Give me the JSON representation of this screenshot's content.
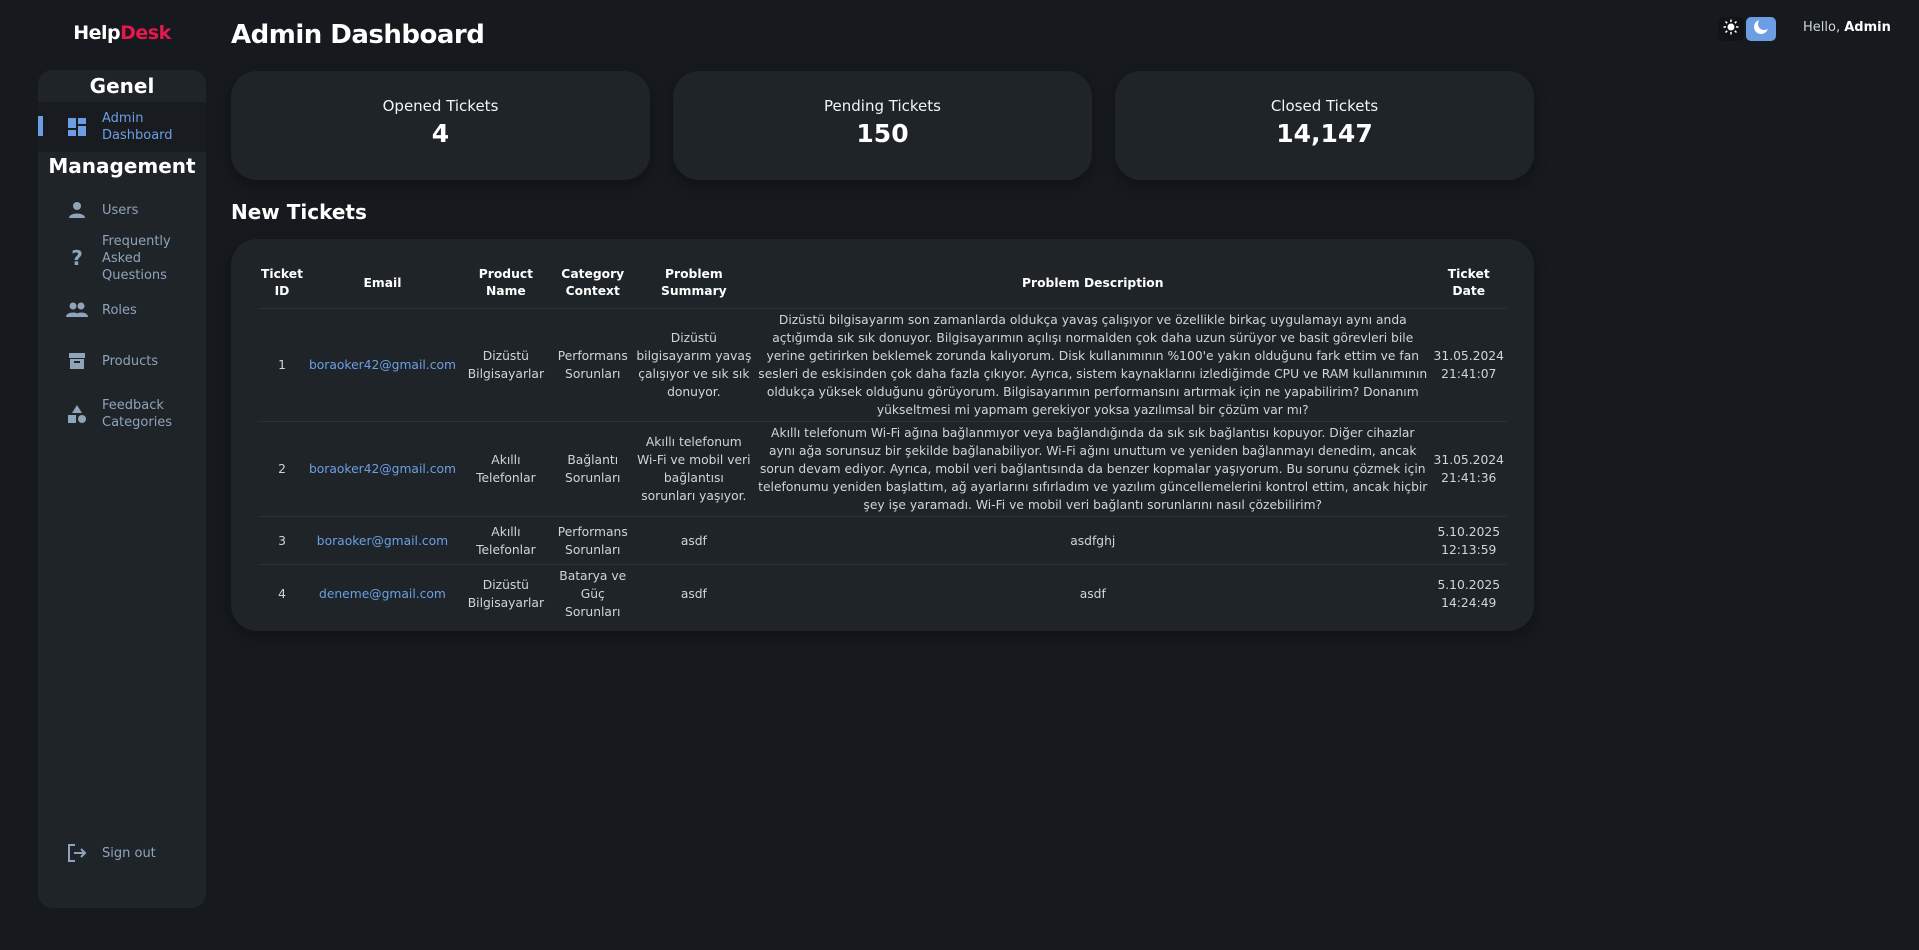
{
  "brand": {
    "part1": "Help",
    "part2": "Desk"
  },
  "sidebar": {
    "section_general": "Genel",
    "section_management": "Management",
    "items": [
      {
        "label": "Admin Dashboard",
        "icon": "dashboard-icon"
      },
      {
        "label": "Users",
        "icon": "user-icon"
      },
      {
        "label": "Frequently Asked Questions",
        "icon": "question-icon"
      },
      {
        "label": "Roles",
        "icon": "group-icon"
      },
      {
        "label": "Products",
        "icon": "archive-icon"
      },
      {
        "label": "Feedback Categories",
        "icon": "category-icon"
      }
    ],
    "sign_out": "Sign out"
  },
  "header": {
    "title": "Admin Dashboard",
    "greeting_prefix": "Hello, ",
    "user": "Admin"
  },
  "stats": [
    {
      "label": "Opened Tickets",
      "value": "4"
    },
    {
      "label": "Pending Tickets",
      "value": "150"
    },
    {
      "label": "Closed Tickets",
      "value": "14,147"
    }
  ],
  "tickets": {
    "heading": "New Tickets",
    "columns": [
      "Ticket ID",
      "Email",
      "Product Name",
      "Category Context",
      "Problem Summary",
      "Problem Description",
      "Ticket Date"
    ],
    "rows": [
      {
        "id": "1",
        "email": "boraoker42@gmail.com",
        "product": "Dizüstü Bilgisayarlar",
        "category": "Performans Sorunları",
        "summary": "Dizüstü bilgisayarım yavaş çalışıyor ve sık sık donuyor.",
        "description": "Dizüstü bilgisayarım son zamanlarda oldukça yavaş çalışıyor ve özellikle birkaç uygulamayı aynı anda açtığımda sık sık donuyor. Bilgisayarımın açılışı normalden çok daha uzun sürüyor ve basit görevleri bile yerine getirirken beklemek zorunda kalıyorum. Disk kullanımının %100'e yakın olduğunu fark ettim ve fan sesleri de eskisinden çok daha fazla çıkıyor. Ayrıca, sistem kaynaklarını izlediğimde CPU ve RAM kullanımının oldukça yüksek olduğunu görüyorum. Bilgisayarımın performansını artırmak için ne yapabilirim? Donanım yükseltmesi mi yapmam gerekiyor yoksa yazılımsal bir çözüm var mı?",
        "date": "31.05.2024 21:41:07"
      },
      {
        "id": "2",
        "email": "boraoker42@gmail.com",
        "product": "Akıllı Telefonlar",
        "category": "Bağlantı Sorunları",
        "summary": "Akıllı telefonum Wi-Fi ve mobil veri bağlantısı sorunları yaşıyor.",
        "description": "Akıllı telefonum Wi-Fi ağına bağlanmıyor veya bağlandığında da sık sık bağlantısı kopuyor. Diğer cihazlar aynı ağa sorunsuz bir şekilde bağlanabiliyor. Wi-Fi ağını unuttum ve yeniden bağlanmayı denedim, ancak sorun devam ediyor. Ayrıca, mobil veri bağlantısında da benzer kopmalar yaşıyorum. Bu sorunu çözmek için telefonumu yeniden başlattım, ağ ayarlarını sıfırladım ve yazılım güncellemelerini kontrol ettim, ancak hiçbir şey işe yaramadı. Wi-Fi ve mobil veri bağlantı sorunlarını nasıl çözebilirim?",
        "date": "31.05.2024 21:41:36"
      },
      {
        "id": "3",
        "email": "boraoker@gmail.com",
        "product": "Akıllı Telefonlar",
        "category": "Performans Sorunları",
        "summary": "asdf",
        "description": "asdfghj",
        "date": "5.10.2025 12:13:59"
      },
      {
        "id": "4",
        "email": "deneme@gmail.com",
        "product": "Dizüstü Bilgisayarlar",
        "category": "Batarya ve Güç Sorunları",
        "summary": "asdf",
        "description": "asdf",
        "date": "5.10.2025 14:24:49"
      }
    ]
  },
  "colors": {
    "accent": "#6d9ee4",
    "brand_red": "#e5184e",
    "background": "#16191d",
    "card": "#1f2428"
  }
}
